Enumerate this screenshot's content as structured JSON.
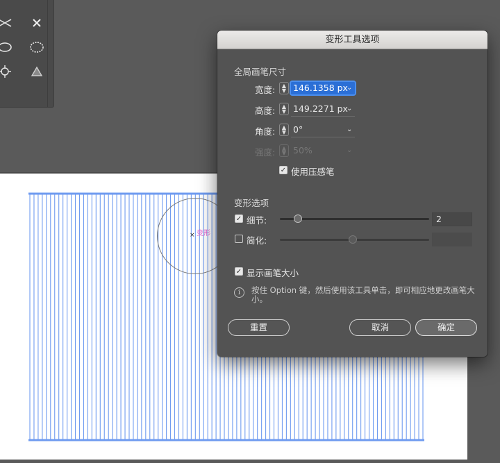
{
  "dialog": {
    "title": "变形工具选项",
    "global_brush_size_label": "全局画笔尺寸",
    "width_label": "宽度:",
    "width_value": "146.1358 px",
    "height_label": "高度:",
    "height_value": "149.2271 px",
    "angle_label": "角度:",
    "angle_value": "0°",
    "intensity_label": "强度:",
    "intensity_value": "50%",
    "use_pressure_pen_label": "使用压感笔",
    "use_pressure_pen_checked": true,
    "warp_options_label": "变形选项",
    "detail_label": "细节:",
    "detail_checked": true,
    "detail_value": "2",
    "simplify_label": "简化:",
    "simplify_checked": false,
    "show_brush_size_label": "显示画笔大小",
    "show_brush_size_checked": true,
    "info_text": "按住 Option 键，然后使用该工具单击，即可相应地更改画笔大小。",
    "reset_label": "重置",
    "cancel_label": "取消",
    "ok_label": "确定"
  },
  "canvas": {
    "brush_cursor_label": "变形",
    "line_color": "#6f9bf0",
    "artboard_color": "#ffffff"
  },
  "tools": [
    "scissors-icon",
    "close-icon",
    "ellipse-icon",
    "warp-ellipse-icon",
    "crosshair-icon",
    "triangle-icon"
  ]
}
